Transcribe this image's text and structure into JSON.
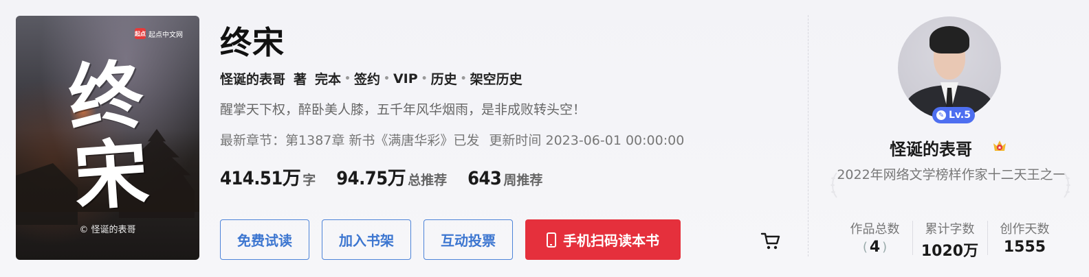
{
  "cover": {
    "brand": "起点中文网",
    "brand_logo": "起点",
    "big_title": "终宋",
    "copyright": "© 怪诞的表哥"
  },
  "book": {
    "title": "终宋",
    "author": "怪诞的表哥",
    "author_suffix": "著",
    "status": "完本",
    "sign": "签约",
    "vip": "VIP",
    "category": "历史",
    "subcategory": "架空历史",
    "intro": "醒掌天下权，醉卧美人膝，五千年风华烟雨，是非成败转头空！",
    "latest_label": "最新章节：",
    "latest_chapter": "第1387章 新书《满唐华彩》已发",
    "update_label": "更新时间",
    "update_time": "2023-06-01 00:00:00"
  },
  "stats": {
    "words": "414.51万",
    "words_unit": "字",
    "recommend": "94.75万",
    "recommend_unit": "总推荐",
    "weekly": "643",
    "weekly_unit": "周推荐"
  },
  "actions": {
    "free_read": "免费试读",
    "add_shelf": "加入书架",
    "vote": "互动投票",
    "mobile_read": "手机扫码读本书"
  },
  "author": {
    "level": "Lv.5",
    "name": "怪诞的表哥",
    "honor": "2022年网络文学榜样作家十二天王之一",
    "works_label": "作品总数",
    "works_value": "4",
    "words_label": "累计字数",
    "words_value": "1020万",
    "days_label": "创作天数",
    "days_value": "1555"
  },
  "colors": {
    "accent_blue": "#3c76d0",
    "accent_red": "#e5303c",
    "level_blue": "#4e6ff0"
  }
}
